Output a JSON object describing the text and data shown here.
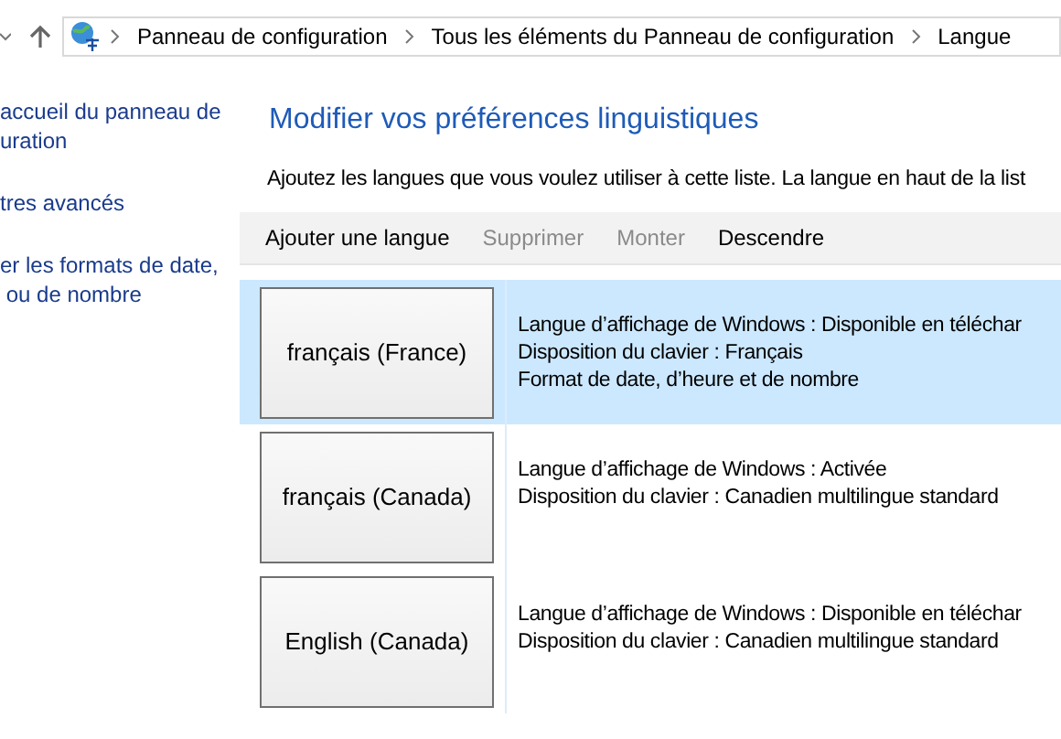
{
  "address_bar": {
    "crumbs": [
      "Panneau de configuration",
      "Tous les éléments du Panneau de configuration",
      "Langue"
    ]
  },
  "sidebar": {
    "links": [
      "accueil du panneau de\nuration",
      "tres avancés",
      "er les formats de date,\n ou de nombre"
    ]
  },
  "heading": "Modifier vos préférences linguistiques",
  "description": "Ajoutez les langues que vous voulez utiliser à cette liste. La langue en haut de la list",
  "toolbar": [
    {
      "label": "Ajouter une langue",
      "disabled": false
    },
    {
      "label": "Supprimer",
      "disabled": true
    },
    {
      "label": "Monter",
      "disabled": true
    },
    {
      "label": "Descendre",
      "disabled": false
    }
  ],
  "languages": [
    {
      "name": "français (France)",
      "selected": true,
      "details": [
        "Langue d’affichage de Windows : Disponible en téléchar",
        "Disposition du clavier : Français",
        "Format de date, d’heure et de nombre"
      ]
    },
    {
      "name": "français (Canada)",
      "selected": false,
      "details": [
        "Langue d’affichage de Windows : Activée",
        "Disposition du clavier : Canadien multilingue standard"
      ]
    },
    {
      "name": "English (Canada)",
      "selected": false,
      "details": [
        "Langue d’affichage de Windows : Disponible en téléchar",
        "Disposition du clavier : Canadien multilingue standard"
      ]
    }
  ]
}
